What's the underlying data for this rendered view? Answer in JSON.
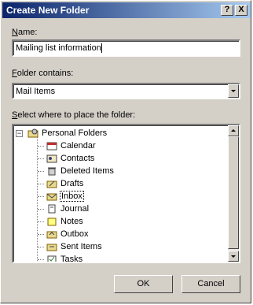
{
  "window": {
    "title": "Create New Folder",
    "help_label": "?",
    "close_label": "X"
  },
  "name_field": {
    "label": "Name:",
    "value": "Mailing list information"
  },
  "folder_contains": {
    "label": "Folder contains:",
    "value": "Mail Items"
  },
  "tree": {
    "label": "Select where to place the folder:",
    "root": {
      "label": "Personal Folders",
      "icon": "personal-folders-icon",
      "expander": "−"
    },
    "items": [
      {
        "label": "Calendar",
        "icon": "calendar-icon"
      },
      {
        "label": "Contacts",
        "icon": "contacts-icon"
      },
      {
        "label": "Deleted Items",
        "icon": "deleted-items-icon"
      },
      {
        "label": "Drafts",
        "icon": "drafts-icon"
      },
      {
        "label": "Inbox",
        "icon": "inbox-icon"
      },
      {
        "label": "Journal",
        "icon": "journal-icon"
      },
      {
        "label": "Notes",
        "icon": "notes-icon"
      },
      {
        "label": "Outbox",
        "icon": "outbox-icon"
      },
      {
        "label": "Sent Items",
        "icon": "sent-items-icon"
      },
      {
        "label": "Tasks",
        "icon": "tasks-icon"
      }
    ],
    "selected": "Inbox"
  },
  "buttons": {
    "ok": "OK",
    "cancel": "Cancel"
  },
  "colors": {
    "titlebar_start": "#0a246a",
    "titlebar_end": "#a6caf0",
    "face": "#d4d0c8"
  }
}
